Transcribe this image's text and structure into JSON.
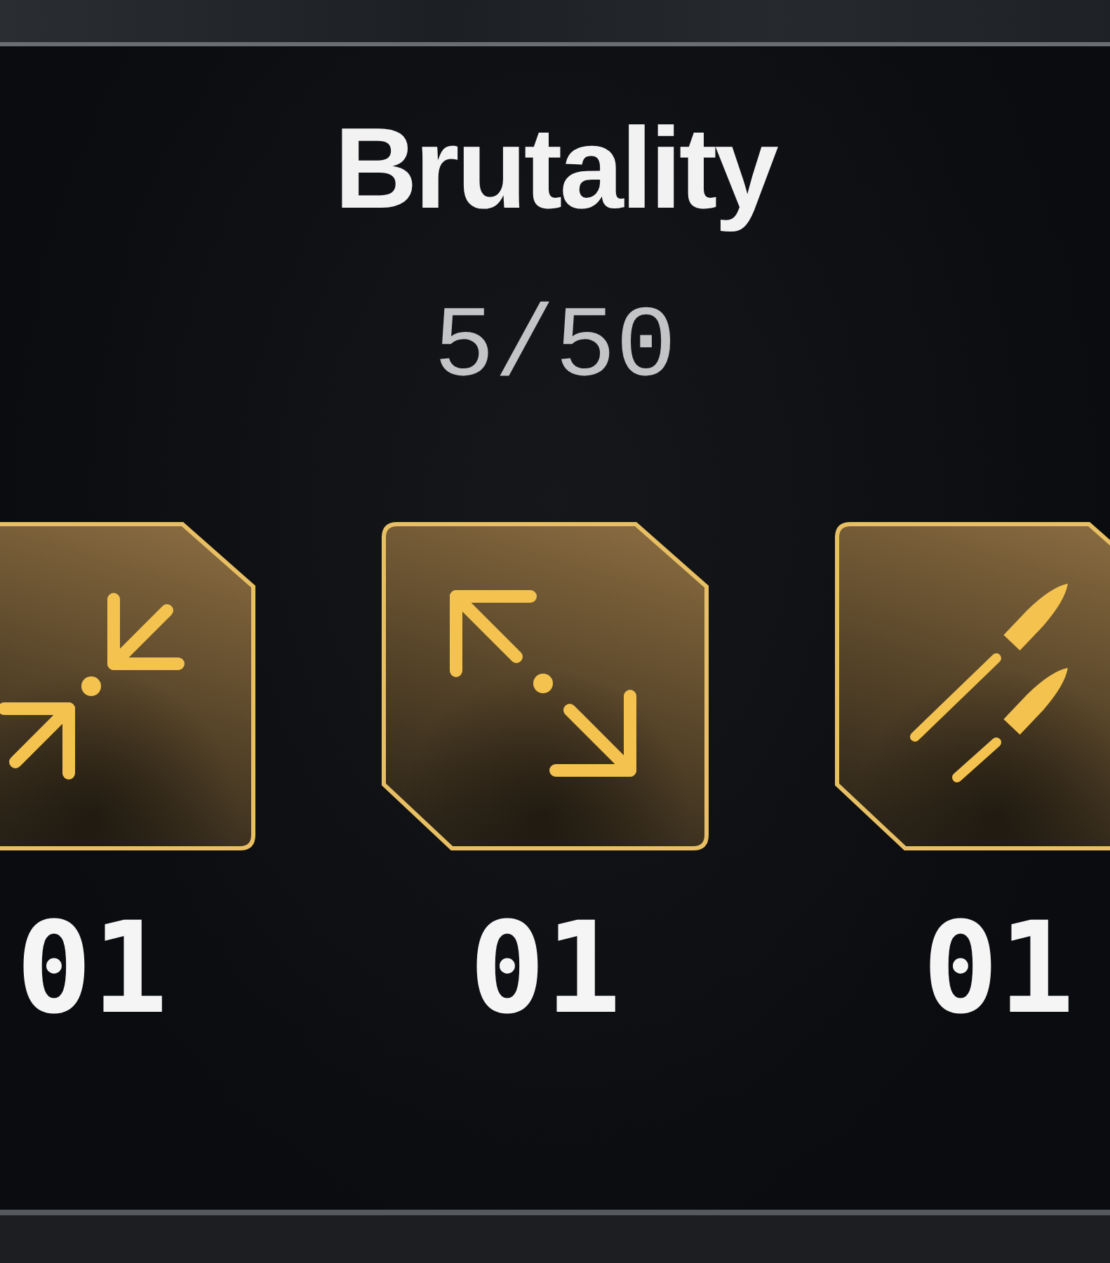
{
  "title": "Brutality",
  "progress": "5/50",
  "rewards": [
    {
      "kind": "compress",
      "count": "01"
    },
    {
      "kind": "expand",
      "count": "01"
    },
    {
      "kind": "bullets",
      "count": "01"
    }
  ]
}
